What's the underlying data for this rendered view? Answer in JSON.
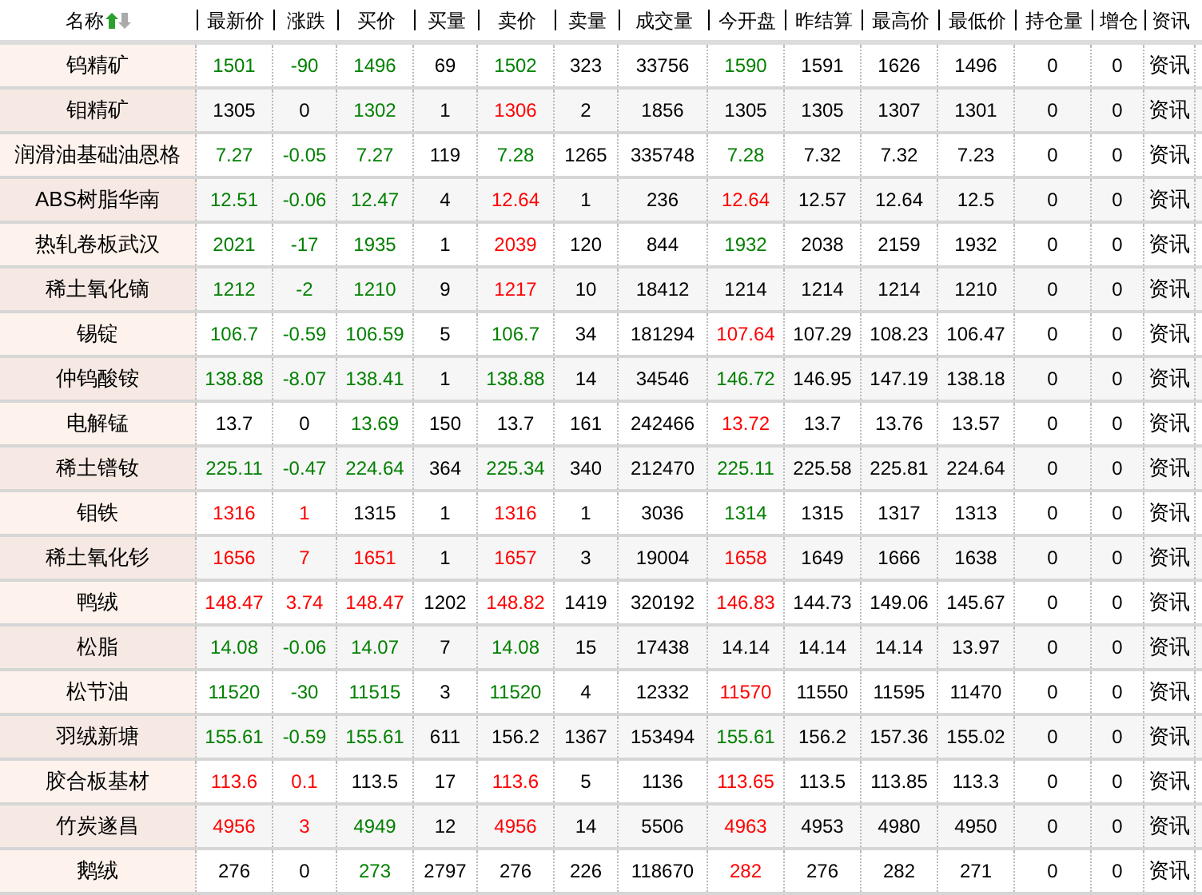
{
  "table": {
    "columns": [
      "名称",
      "最新价",
      "涨跌",
      "买价",
      "买量",
      "卖价",
      "卖量",
      "成交量",
      "今开盘",
      "昨结算",
      "最高价",
      "最低价",
      "持仓量",
      "增仓",
      "资讯"
    ],
    "rows": [
      {
        "cells": [
          "钨精矿",
          {
            "text": "1501",
            "color": "#008000"
          },
          {
            "text": "-90",
            "color": "#008000"
          },
          {
            "text": "1496",
            "color": "#008000"
          },
          "69",
          {
            "text": "1502",
            "color": "#008000"
          },
          "323",
          "33756",
          {
            "text": "1590",
            "color": "#008000"
          },
          "1591",
          "1626",
          "1496",
          "0",
          "0",
          "资讯"
        ]
      },
      {
        "cells": [
          "钼精矿",
          "1305",
          "0",
          {
            "text": "1302",
            "color": "#008000"
          },
          "1",
          {
            "text": "1306",
            "color": "#ff0000"
          },
          "2",
          "1856",
          "1305",
          "1305",
          "1307",
          "1301",
          "0",
          "0",
          "资讯"
        ]
      },
      {
        "cells": [
          "润滑油基础油恩格",
          {
            "text": "7.27",
            "color": "#008000"
          },
          {
            "text": "-0.05",
            "color": "#008000"
          },
          {
            "text": "7.27",
            "color": "#008000"
          },
          "119",
          {
            "text": "7.28",
            "color": "#008000"
          },
          "1265",
          "335748",
          {
            "text": "7.28",
            "color": "#008000"
          },
          "7.32",
          "7.32",
          "7.23",
          "0",
          "0",
          "资讯"
        ]
      },
      {
        "cells": [
          "ABS树脂华南",
          {
            "text": "12.51",
            "color": "#008000"
          },
          {
            "text": "-0.06",
            "color": "#008000"
          },
          {
            "text": "12.47",
            "color": "#008000"
          },
          "4",
          {
            "text": "12.64",
            "color": "#ff0000"
          },
          "1",
          "236",
          {
            "text": "12.64",
            "color": "#ff0000"
          },
          "12.57",
          "12.64",
          "12.5",
          "0",
          "0",
          "资讯"
        ]
      },
      {
        "cells": [
          "热轧卷板武汉",
          {
            "text": "2021",
            "color": "#008000"
          },
          {
            "text": "-17",
            "color": "#008000"
          },
          {
            "text": "1935",
            "color": "#008000"
          },
          "1",
          {
            "text": "2039",
            "color": "#ff0000"
          },
          "120",
          "844",
          {
            "text": "1932",
            "color": "#008000"
          },
          "2038",
          "2159",
          "1932",
          "0",
          "0",
          "资讯"
        ]
      },
      {
        "cells": [
          "稀土氧化镝",
          {
            "text": "1212",
            "color": "#008000"
          },
          {
            "text": "-2",
            "color": "#008000"
          },
          {
            "text": "1210",
            "color": "#008000"
          },
          "9",
          {
            "text": "1217",
            "color": "#ff0000"
          },
          "10",
          "18412",
          "1214",
          "1214",
          "1214",
          "1210",
          "0",
          "0",
          "资讯"
        ]
      },
      {
        "cells": [
          "锡锭",
          {
            "text": "106.7",
            "color": "#008000"
          },
          {
            "text": "-0.59",
            "color": "#008000"
          },
          {
            "text": "106.59",
            "color": "#008000"
          },
          "5",
          {
            "text": "106.7",
            "color": "#008000"
          },
          "34",
          "181294",
          {
            "text": "107.64",
            "color": "#ff0000"
          },
          "107.29",
          "108.23",
          "106.47",
          "0",
          "0",
          "资讯"
        ]
      },
      {
        "cells": [
          "仲钨酸铵",
          {
            "text": "138.88",
            "color": "#008000"
          },
          {
            "text": "-8.07",
            "color": "#008000"
          },
          {
            "text": "138.41",
            "color": "#008000"
          },
          "1",
          {
            "text": "138.88",
            "color": "#008000"
          },
          "14",
          "34546",
          {
            "text": "146.72",
            "color": "#008000"
          },
          "146.95",
          "147.19",
          "138.18",
          "0",
          "0",
          "资讯"
        ]
      },
      {
        "cells": [
          "电解锰",
          "13.7",
          "0",
          {
            "text": "13.69",
            "color": "#008000"
          },
          "150",
          "13.7",
          "161",
          "242466",
          {
            "text": "13.72",
            "color": "#ff0000"
          },
          "13.7",
          "13.76",
          "13.57",
          "0",
          "0",
          "资讯"
        ]
      },
      {
        "cells": [
          "稀土镨钕",
          {
            "text": "225.11",
            "color": "#008000"
          },
          {
            "text": "-0.47",
            "color": "#008000"
          },
          {
            "text": "224.64",
            "color": "#008000"
          },
          "364",
          {
            "text": "225.34",
            "color": "#008000"
          },
          "340",
          "212470",
          {
            "text": "225.11",
            "color": "#008000"
          },
          "225.58",
          "225.81",
          "224.64",
          "0",
          "0",
          "资讯"
        ]
      },
      {
        "cells": [
          "钼铁",
          {
            "text": "1316",
            "color": "#ff0000"
          },
          {
            "text": "1",
            "color": "#ff0000"
          },
          "1315",
          "1",
          {
            "text": "1316",
            "color": "#ff0000"
          },
          "1",
          "3036",
          {
            "text": "1314",
            "color": "#008000"
          },
          "1315",
          "1317",
          "1313",
          "0",
          "0",
          "资讯"
        ]
      },
      {
        "cells": [
          "稀土氧化钐",
          {
            "text": "1656",
            "color": "#ff0000"
          },
          {
            "text": "7",
            "color": "#ff0000"
          },
          {
            "text": "1651",
            "color": "#ff0000"
          },
          "1",
          {
            "text": "1657",
            "color": "#ff0000"
          },
          "3",
          "19004",
          {
            "text": "1658",
            "color": "#ff0000"
          },
          "1649",
          "1666",
          "1638",
          "0",
          "0",
          "资讯"
        ]
      },
      {
        "cells": [
          "鸭绒",
          {
            "text": "148.47",
            "color": "#ff0000"
          },
          {
            "text": "3.74",
            "color": "#ff0000"
          },
          {
            "text": "148.47",
            "color": "#ff0000"
          },
          "1202",
          {
            "text": "148.82",
            "color": "#ff0000"
          },
          "1419",
          "320192",
          {
            "text": "146.83",
            "color": "#ff0000"
          },
          "144.73",
          "149.06",
          "145.67",
          "0",
          "0",
          "资讯"
        ]
      },
      {
        "cells": [
          "松脂",
          {
            "text": "14.08",
            "color": "#008000"
          },
          {
            "text": "-0.06",
            "color": "#008000"
          },
          {
            "text": "14.07",
            "color": "#008000"
          },
          "7",
          {
            "text": "14.08",
            "color": "#008000"
          },
          "15",
          "17438",
          "14.14",
          "14.14",
          "14.14",
          "13.97",
          "0",
          "0",
          "资讯"
        ]
      },
      {
        "cells": [
          "松节油",
          {
            "text": "11520",
            "color": "#008000"
          },
          {
            "text": "-30",
            "color": "#008000"
          },
          {
            "text": "11515",
            "color": "#008000"
          },
          "3",
          {
            "text": "11520",
            "color": "#008000"
          },
          "4",
          "12332",
          {
            "text": "11570",
            "color": "#ff0000"
          },
          "11550",
          "11595",
          "11470",
          "0",
          "0",
          "资讯"
        ]
      },
      {
        "cells": [
          "羽绒新塘",
          {
            "text": "155.61",
            "color": "#008000"
          },
          {
            "text": "-0.59",
            "color": "#008000"
          },
          {
            "text": "155.61",
            "color": "#008000"
          },
          "611",
          "156.2",
          "1367",
          "153494",
          {
            "text": "155.61",
            "color": "#008000"
          },
          "156.2",
          "157.36",
          "155.02",
          "0",
          "0",
          "资讯"
        ]
      },
      {
        "cells": [
          "胶合板基材",
          {
            "text": "113.6",
            "color": "#ff0000"
          },
          {
            "text": "0.1",
            "color": "#ff0000"
          },
          "113.5",
          "17",
          {
            "text": "113.6",
            "color": "#ff0000"
          },
          "5",
          "1136",
          {
            "text": "113.65",
            "color": "#ff0000"
          },
          "113.5",
          "113.85",
          "113.3",
          "0",
          "0",
          "资讯"
        ]
      },
      {
        "cells": [
          "竹炭遂昌",
          {
            "text": "4956",
            "color": "#ff0000"
          },
          {
            "text": "3",
            "color": "#ff0000"
          },
          {
            "text": "4949",
            "color": "#008000"
          },
          "12",
          {
            "text": "4956",
            "color": "#ff0000"
          },
          "14",
          "5506",
          {
            "text": "4963",
            "color": "#ff0000"
          },
          "4953",
          "4980",
          "4950",
          "0",
          "0",
          "资讯"
        ]
      },
      {
        "cells": [
          "鹅绒",
          "276",
          "0",
          {
            "text": "273",
            "color": "#008000"
          },
          "2797",
          "276",
          "226",
          "118670",
          {
            "text": "282",
            "color": "#ff0000"
          },
          "276",
          "282",
          "271",
          "0",
          "0",
          "资讯"
        ]
      }
    ]
  }
}
